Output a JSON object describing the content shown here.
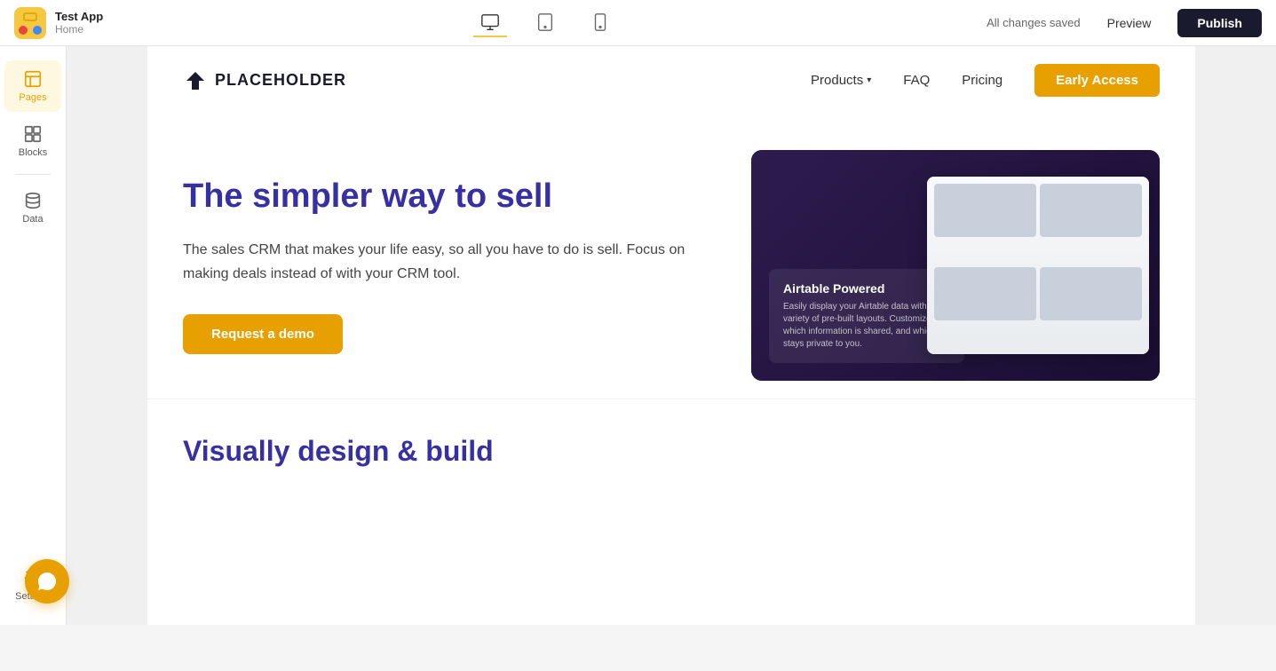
{
  "topbar": {
    "app_name": "Test App",
    "app_page": "Home",
    "all_changes_saved": "All changes saved",
    "preview_label": "Preview",
    "publish_label": "Publish"
  },
  "sidebar": {
    "items": [
      {
        "id": "pages",
        "label": "Pages",
        "icon": "pages-icon"
      },
      {
        "id": "blocks",
        "label": "Blocks",
        "icon": "blocks-icon"
      },
      {
        "id": "data",
        "label": "Data",
        "icon": "data-icon"
      },
      {
        "id": "settings",
        "label": "Settings",
        "icon": "settings-icon"
      }
    ]
  },
  "site": {
    "logo_text": "PLACEHOLDER",
    "nav": {
      "products_label": "Products",
      "faq_label": "FAQ",
      "pricing_label": "Pricing",
      "early_access_label": "Early Access"
    },
    "hero": {
      "title": "The simpler way to sell",
      "description": "The sales CRM that makes your life easy, so all you have to do is sell. Focus on making deals instead of with your CRM tool.",
      "cta_label": "Request a demo"
    },
    "airtable_card": {
      "title": "Airtable Powered",
      "description": "Easily display your Airtable data with a variety of pre-built layouts. Customize which information is shared, and which stays private to you."
    },
    "second_section": {
      "title": "Visually design & build"
    }
  }
}
